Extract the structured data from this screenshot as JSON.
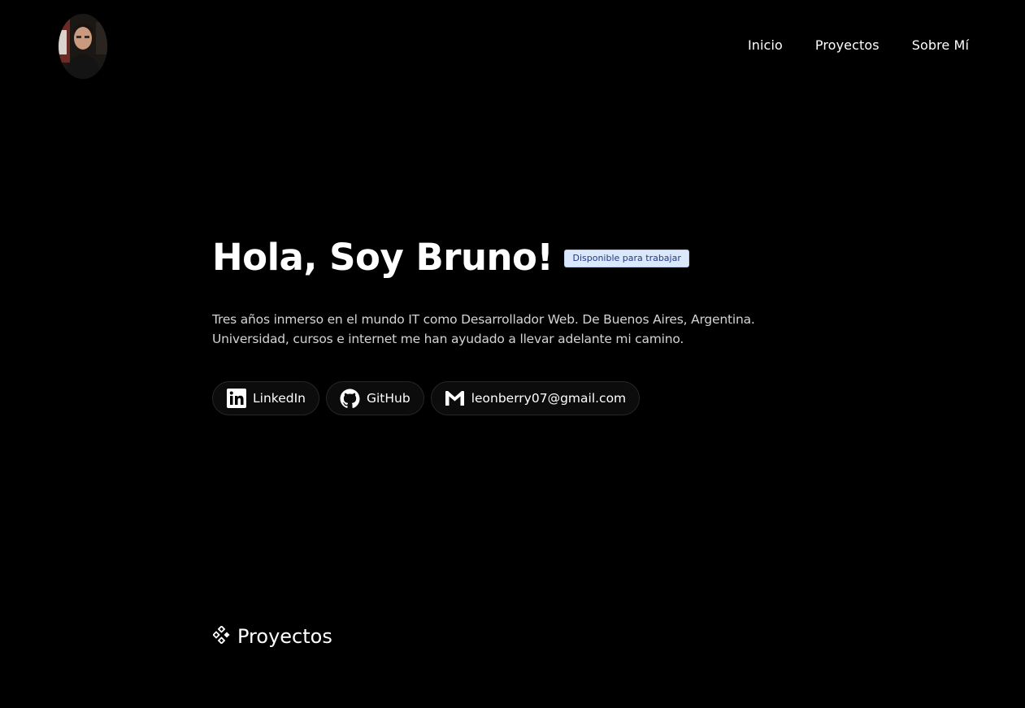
{
  "header": {
    "avatar_alt": "Bruno",
    "nav": [
      {
        "label": "Inicio"
      },
      {
        "label": "Proyectos"
      },
      {
        "label": "Sobre Mí"
      }
    ]
  },
  "hero": {
    "title": "Hola, Soy Bruno!",
    "badge": "Disponible para trabajar",
    "bio_line_1": "Tres años inmerso en el mundo IT como Desarrollador Web. De Buenos Aires, Argentina.",
    "bio_line_2": "Universidad, cursos e internet me han ayudado a llevar adelante mi camino.",
    "links": [
      {
        "label": "LinkedIn",
        "icon": "linkedin-icon"
      },
      {
        "label": "GitHub",
        "icon": "github-icon"
      },
      {
        "label": "leonberry07@gmail.com",
        "icon": "gmail-icon"
      }
    ]
  },
  "projects_section": {
    "heading": "Proyectos",
    "icon": "code-diamond-icon"
  },
  "colors": {
    "background": "#000000",
    "text": "#ffffff",
    "bio_text": "#d4d4d4",
    "badge_bg": "#dbe8fb",
    "badge_text": "#1e3a8a",
    "pill_border": "#262626"
  }
}
